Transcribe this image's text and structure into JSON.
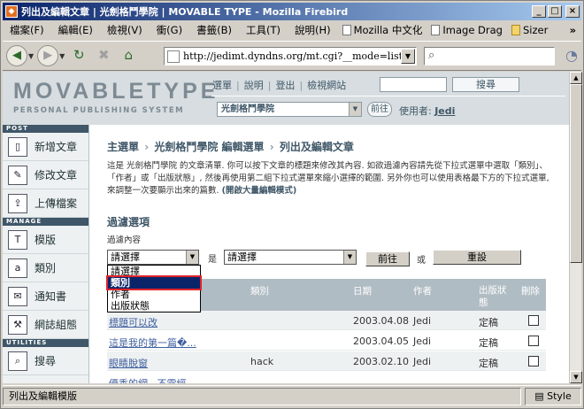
{
  "window": {
    "title": "列出及編輯文章 | 光劍格鬥學院 | MOVABLE TYPE - Mozilla Firebird",
    "min": "_",
    "max": "□",
    "close": "×"
  },
  "menu": {
    "items": [
      "檔案(F)",
      "編輯(E)",
      "檢視(V)",
      "衝(G)",
      "書籤(B)",
      "工具(T)",
      "說明(H)"
    ],
    "bookmarks": [
      "Mozilla 中文化",
      "Image Drag",
      "Sizer"
    ],
    "more": "»"
  },
  "nav": {
    "url": "http://jedimt.dyndns.org/mt.cgi?__mode=list_entrie"
  },
  "mt": {
    "logo": "MOVABLETYPE",
    "logo_sub": "PERSONAL PUBLISHING SYSTEM",
    "top_links": [
      "選單",
      "說明",
      "登出",
      "檢視網站"
    ],
    "search_button": "搜尋",
    "blog_select": "光劍格鬥學院",
    "go_button": "前往",
    "user_label": "使用者:",
    "user_name": "Jedi"
  },
  "sidebar": {
    "sections": [
      {
        "header": "POST",
        "items": [
          {
            "icon": "new-entry-icon",
            "label": "新增文章"
          },
          {
            "icon": "edit-entries-icon",
            "label": "修改文章"
          },
          {
            "icon": "upload-icon",
            "label": "上傳檔案"
          }
        ]
      },
      {
        "header": "MANAGE",
        "items": [
          {
            "icon": "template-icon",
            "label": "模版"
          },
          {
            "icon": "category-icon",
            "label": "類別"
          },
          {
            "icon": "notify-icon",
            "label": "通知書"
          },
          {
            "icon": "config-icon",
            "label": "網誌組態"
          }
        ]
      },
      {
        "header": "UTILITIES",
        "items": [
          {
            "icon": "search-icon",
            "label": "搜尋"
          }
        ]
      }
    ]
  },
  "main": {
    "breadcrumb": [
      "主選單",
      "光劍格鬥學院 編輯選單",
      "列出及編輯文章"
    ],
    "breadcrumb_sep": "›",
    "intro": "這是 光劍格鬥學院 的文章清單. 你可以按下文章的標題來修改其內容. 如欲過濾內容請先從下拉式選單中選取「類別」、「作者」或「出版狀態」, 然後再使用第二組下拉式選單來縮小選擇的範圍. 另外你也可以使用表格最下方的下拉式選單, 來調整一次要顯示出來的篇數.",
    "intro_link": "(開啟大量編輯模式)",
    "filter_heading": "過濾選項",
    "filter_sub": "過濾內容",
    "filter_select": "請選擇",
    "is_label": "是",
    "value_select": "請選擇",
    "filter_button": "前往",
    "or_label": "或",
    "reset_button": "重設",
    "dropdown_options": [
      "請選擇",
      "類別",
      "作者",
      "出版狀態"
    ],
    "dropdown_highlighted": 1,
    "table_headers": [
      "類別",
      "日期",
      "作者",
      "出版狀態",
      "刪除"
    ],
    "rows": [
      {
        "title": "標題可以改",
        "category": "",
        "date": "2003.04.08",
        "author": "Jedi",
        "status": "定稿"
      },
      {
        "title": "這是我的第一篇�...",
        "category": "",
        "date": "2003.04.05",
        "author": "Jedi",
        "status": "定稿"
      },
      {
        "title": "眼睛脫窗",
        "category": "hack",
        "date": "2003.02.10",
        "author": "Jedi",
        "status": "定稿"
      },
      {
        "title": "優秀的網...不需經",
        "category": "",
        "date": "",
        "author": "",
        "status": ""
      }
    ]
  },
  "status": {
    "text": "列出及編輯模版",
    "style": "Style"
  }
}
